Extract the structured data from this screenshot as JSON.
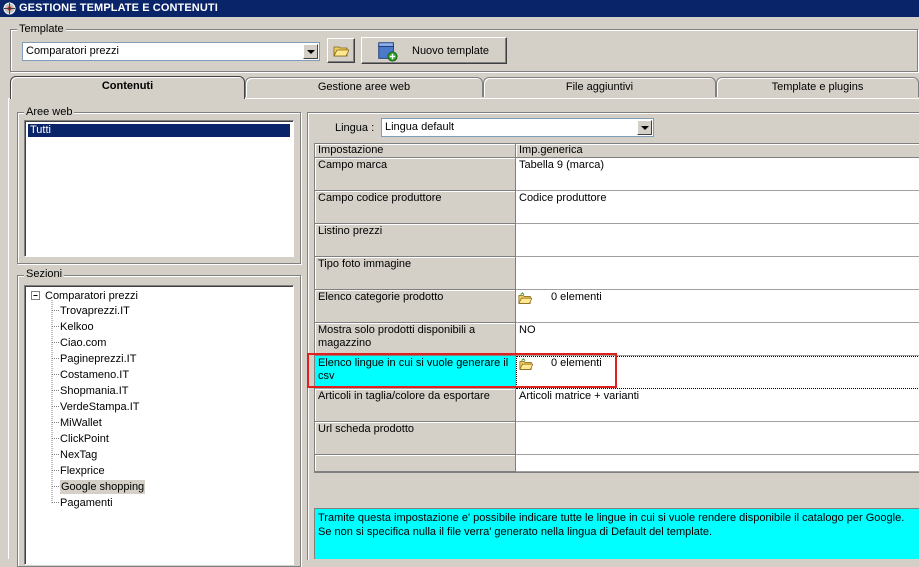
{
  "window": {
    "title": "GESTIONE TEMPLATE E CONTENUTI",
    "icon": "app-icon"
  },
  "template_group": {
    "label": "Template",
    "selected": "Comparatori prezzi",
    "open_icon": "folder-open-icon",
    "new_button_label": "Nuovo template",
    "new_button_icon": "new-template-icon"
  },
  "tabs": [
    {
      "label": "Contenuti",
      "active": true
    },
    {
      "label": "Gestione aree web",
      "active": false
    },
    {
      "label": "File aggiuntivi",
      "active": false
    },
    {
      "label": "Template e plugins",
      "active": false
    }
  ],
  "aree_web": {
    "label": "Aree web",
    "items": [
      "Tutti"
    ],
    "selected": "Tutti"
  },
  "sezioni": {
    "label": "Sezioni",
    "root": "Comparatori prezzi",
    "children": [
      "Trovaprezzi.IT",
      "Kelkoo",
      "Ciao.com",
      "Pagineprezzi.IT",
      "Costameno.IT",
      "Shopmania.IT",
      "VerdeStampa.IT",
      "MiWallet",
      "ClickPoint",
      "NexTag",
      "Flexprice",
      "Google shopping",
      "Pagamenti"
    ],
    "selected": "Google shopping"
  },
  "lingua": {
    "label": "Lingua :",
    "selected": "Lingua default"
  },
  "settings_grid": {
    "columns": [
      "Impostazione",
      "Imp.generica"
    ],
    "rows": [
      {
        "setting": "Campo marca",
        "value": "Tabella 9 (marca)",
        "has_icon": false
      },
      {
        "setting": "Campo codice produttore",
        "value": "Codice produttore",
        "has_icon": false
      },
      {
        "setting": "Listino prezzi",
        "value": "",
        "has_icon": false
      },
      {
        "setting": "Tipo foto immagine",
        "value": "",
        "has_icon": false
      },
      {
        "setting": "Elenco categorie prodotto",
        "value": "0 elementi",
        "has_icon": true
      },
      {
        "setting": "Mostra solo prodotti disponibili a magazzino",
        "value": "NO",
        "has_icon": false
      },
      {
        "setting": "Elenco lingue in cui si vuole generare il csv",
        "value": "0 elementi",
        "has_icon": true,
        "selected": true
      },
      {
        "setting": "Articoli in taglia/colore da esportare",
        "value": "Articoli matrice + varianti",
        "has_icon": false
      },
      {
        "setting": "Url scheda prodotto",
        "value": "",
        "has_icon": false
      }
    ]
  },
  "description": {
    "line1": "Tramite questa impostazione e' possibile indicare tutte le lingue in cui si vuole rendere disponibile il catalogo per Google.",
    "line2": "Se non si specifica nulla il file verra' generato nella lingua di Default del template."
  },
  "colors": {
    "titlebar": "#0a246a",
    "selected_cell": "#00ffff",
    "highlight_box": "#e0201c"
  }
}
